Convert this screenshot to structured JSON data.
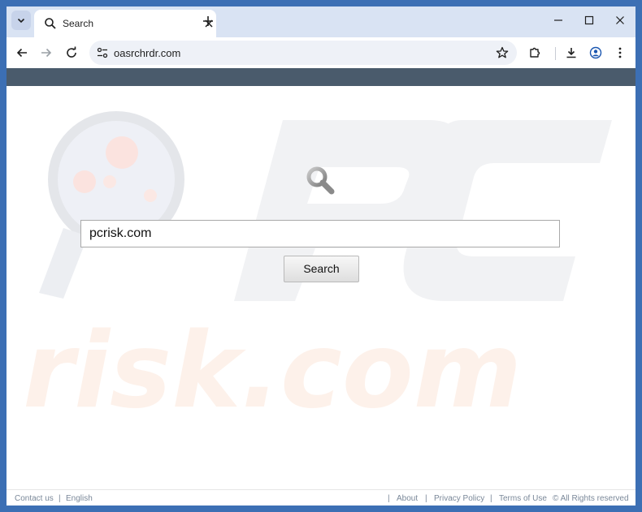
{
  "browser": {
    "tab": {
      "title": "Search"
    },
    "address_bar": {
      "url": "oasrchrdr.com"
    }
  },
  "colors": {
    "accent": "#3c6fb4",
    "page_header": "#4a5b6c",
    "tabstrip": "#d9e3f3"
  },
  "search": {
    "input_value": "pcrisk.com",
    "button_label": "Search"
  },
  "watermark": {
    "text": "risk.com"
  },
  "footer": {
    "contact": "Contact us",
    "sep1": "|",
    "language": "English",
    "sep2": "|",
    "about": "About",
    "sep3": "|",
    "privacy": "Privacy Policy",
    "sep4": "|",
    "terms": "Terms of Use",
    "copyright": "© All Rights reserved"
  },
  "icons": [
    "chevron-down-icon",
    "search-icon",
    "close-icon",
    "plus-icon",
    "minimize-icon",
    "maximize-icon",
    "back-arrow-icon",
    "forward-arrow-icon",
    "reload-icon",
    "site-info-icon",
    "star-icon",
    "extensions-icon",
    "download-icon",
    "profile-icon",
    "kebab-menu-icon",
    "magnifier-icon"
  ]
}
